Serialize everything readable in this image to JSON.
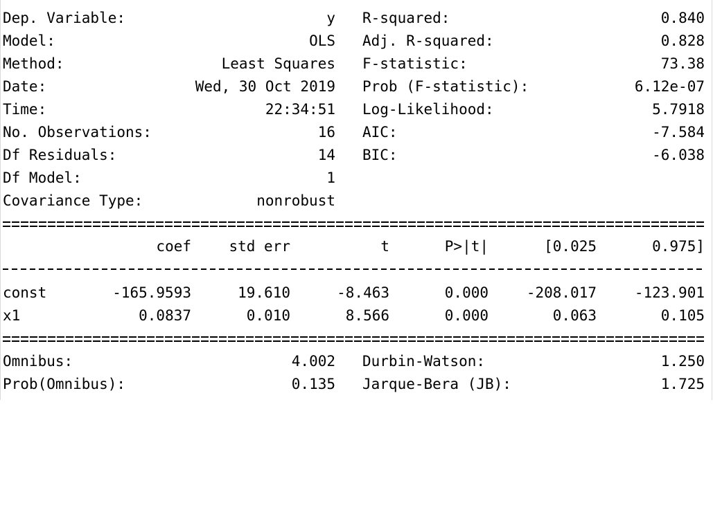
{
  "header": {
    "left": [
      {
        "label": "Dep. Variable:",
        "value": "y"
      },
      {
        "label": "Model:",
        "value": "OLS"
      },
      {
        "label": "Method:",
        "value": "Least Squares"
      },
      {
        "label": "Date:",
        "value": "Wed, 30 Oct 2019"
      },
      {
        "label": "Time:",
        "value": "22:34:51"
      },
      {
        "label": "No. Observations:",
        "value": "16"
      },
      {
        "label": "Df Residuals:",
        "value": "14"
      },
      {
        "label": "Df Model:",
        "value": "1"
      },
      {
        "label": "Covariance Type:",
        "value": "nonrobust"
      }
    ],
    "right": [
      {
        "label": "R-squared:",
        "value": "0.840"
      },
      {
        "label": "Adj. R-squared:",
        "value": "0.828"
      },
      {
        "label": "F-statistic:",
        "value": "73.38"
      },
      {
        "label": "Prob (F-statistic):",
        "value": "6.12e-07"
      },
      {
        "label": "Log-Likelihood:",
        "value": "5.7918"
      },
      {
        "label": "AIC:",
        "value": "-7.584"
      },
      {
        "label": "BIC:",
        "value": "-6.038"
      }
    ]
  },
  "coef_table": {
    "columns": [
      "coef",
      "std err",
      "t",
      "P>|t|",
      "[0.025",
      "0.975]"
    ],
    "rows": [
      {
        "name": "const",
        "values": [
          "-165.9593",
          "19.610",
          "-8.463",
          "0.000",
          "-208.017",
          "-123.901"
        ]
      },
      {
        "name": "x1",
        "values": [
          "0.0837",
          "0.010",
          "8.566",
          "0.000",
          "0.063",
          "0.105"
        ]
      }
    ]
  },
  "diagnostics": {
    "left": [
      {
        "label": "Omnibus:",
        "value": "4.002"
      },
      {
        "label": "Prob(Omnibus):",
        "value": "0.135"
      }
    ],
    "right": [
      {
        "label": "Durbin-Watson:",
        "value": "1.250"
      },
      {
        "label": "Jarque-Bera (JB):",
        "value": "1.725"
      }
    ]
  }
}
